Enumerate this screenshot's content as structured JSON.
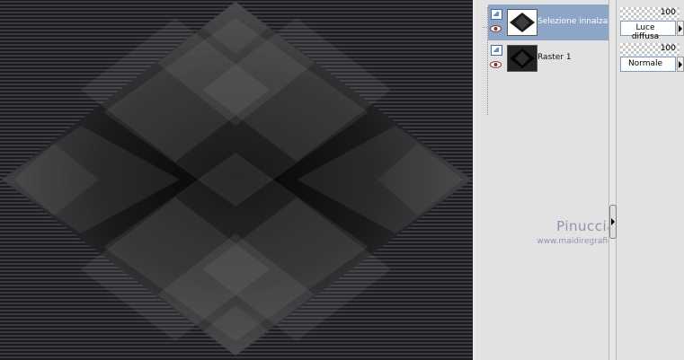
{
  "layers": [
    {
      "name": "Selezione innalzata",
      "selected": true
    },
    {
      "name": "Raster 1",
      "selected": false
    }
  ],
  "properties": [
    {
      "opacity": "100",
      "blend_mode": "Luce diffusa"
    },
    {
      "opacity": "100",
      "blend_mode": "Normale"
    }
  ],
  "watermark": {
    "name": "Pinuccia",
    "url": "www.maidiregrafica.eu"
  },
  "icons": {
    "layer_type": "raster-layer-icon",
    "visibility": "eye-icon",
    "splitter": "collapse-arrow-icon",
    "dropdown": "dropdown-arrow-icon"
  },
  "colors": {
    "selection": "#8da6c8",
    "panel": "#e2e2e2",
    "watermark": "#8f95ae"
  }
}
